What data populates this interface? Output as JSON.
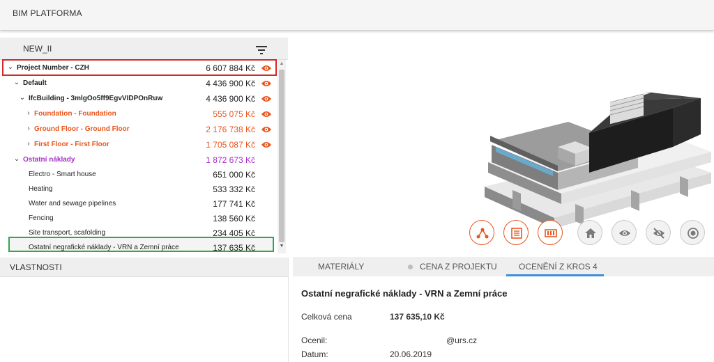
{
  "app": {
    "title": "BIM PLATFORMA"
  },
  "tree": {
    "header": "NEW_II",
    "rows": [
      {
        "label": "Project Number - CZH",
        "price": "6 607 884 Kč"
      },
      {
        "label": "Default",
        "price": "4 436 900 Kč"
      },
      {
        "label": "IfcBuilding - 3mlgOo5ff9EgvVIDPOnRuw",
        "price": "4 436 900 Kč"
      },
      {
        "label": "Foundation - Foundation",
        "price": "555 075 Kč"
      },
      {
        "label": "Ground Floor - Ground Floor",
        "price": "2 176 738 Kč"
      },
      {
        "label": "First Floor - First Floor",
        "price": "1 705 087 Kč"
      },
      {
        "label": "Ostatní náklady",
        "price": "1 872 673 Kč"
      },
      {
        "label": "Electro - Smart house",
        "price": "651 000 Kč"
      },
      {
        "label": "Heating",
        "price": "533 332 Kč"
      },
      {
        "label": "Water and sewage pipelines",
        "price": "177 741 Kč"
      },
      {
        "label": "Fencing",
        "price": "138 560 Kč"
      },
      {
        "label": "Site transport, scafolding",
        "price": "234 405 Kč"
      },
      {
        "label": "Ostatní negrafické náklady - VRN a Zemní práce",
        "price": "137 635 Kč"
      }
    ]
  },
  "properties": {
    "title": "VLASTNOSTI"
  },
  "tabs": [
    {
      "label": "MATERIÁLY"
    },
    {
      "label": "CENA Z PROJEKTU"
    },
    {
      "label": "OCENĚNÍ Z KROS 4"
    }
  ],
  "detail": {
    "title": "Ostatní negrafické náklady - VRN a Zemní práce",
    "total_label": "Celková cena",
    "total_value": "137 635,10 Kč",
    "priced_by_label": "Ocenil:",
    "priced_by_value": "@urs.cz",
    "date_label": "Datum:",
    "date_value": "20.06.2019"
  },
  "viewer": {
    "buttons": [
      "hierarchy-icon",
      "list-icon",
      "panel-icon",
      "home-icon",
      "eye-icon",
      "eye-off-icon",
      "target-icon"
    ]
  },
  "colors": {
    "accent_orange": "#e8561f",
    "accent_purple": "#a830c9",
    "selection_red": "#d42a2a",
    "selection_green": "#2ea84a",
    "tab_active": "#3d8ddb"
  }
}
